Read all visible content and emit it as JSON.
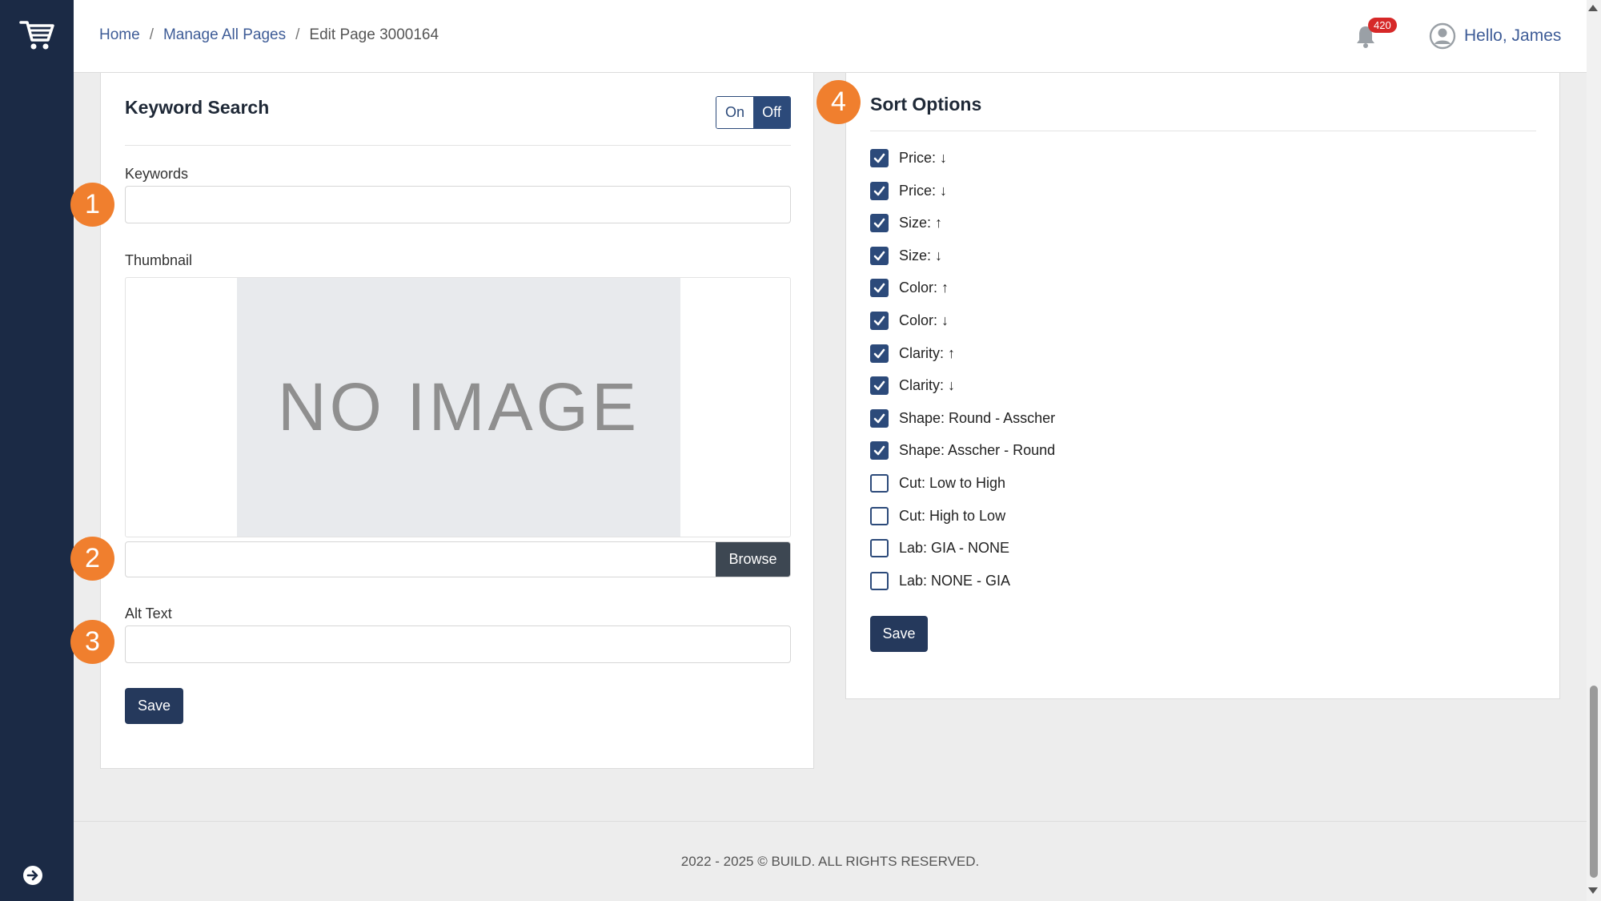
{
  "breadcrumb": {
    "home": "Home",
    "sep1": "/",
    "manage": "Manage All Pages",
    "sep2": "/",
    "current": "Edit Page 3000164"
  },
  "header": {
    "notification_count": "420",
    "greeting": "Hello, James"
  },
  "keyword_search": {
    "title": "Keyword Search",
    "toggle_on": "On",
    "toggle_off": "Off",
    "toggle_selected": "Off",
    "keywords_label": "Keywords",
    "keywords_value": "",
    "thumbnail_label": "Thumbnail",
    "no_image_text": "NO IMAGE",
    "browse_label": "Browse",
    "file_value": "",
    "alt_text_label": "Alt Text",
    "alt_text_value": "",
    "save_label": "Save"
  },
  "sort_options": {
    "title": "Sort Options",
    "save_label": "Save",
    "items": [
      {
        "label": "Price: ↓",
        "checked": true
      },
      {
        "label": "Price: ↓",
        "checked": true
      },
      {
        "label": "Size: ↑",
        "checked": true
      },
      {
        "label": "Size: ↓",
        "checked": true
      },
      {
        "label": "Color: ↑",
        "checked": true
      },
      {
        "label": "Color: ↓",
        "checked": true
      },
      {
        "label": "Clarity: ↑",
        "checked": true
      },
      {
        "label": "Clarity: ↓",
        "checked": true
      },
      {
        "label": "Shape: Round - Asscher",
        "checked": true
      },
      {
        "label": "Shape: Asscher - Round",
        "checked": true
      },
      {
        "label": "Cut: Low to High",
        "checked": false
      },
      {
        "label": "Cut: High to Low",
        "checked": false
      },
      {
        "label": "Lab: GIA - NONE",
        "checked": false
      },
      {
        "label": "Lab: NONE - GIA",
        "checked": false
      }
    ]
  },
  "steps": [
    "1",
    "2",
    "3",
    "4"
  ],
  "footer": {
    "copyright": "2022 - 2025 © BUILD. ALL RIGHTS RESERVED."
  },
  "colors": {
    "sidebar": "#1b2a45",
    "primary": "#2c4a7a",
    "accent_step": "#f07f2e",
    "badge": "#d62828"
  }
}
